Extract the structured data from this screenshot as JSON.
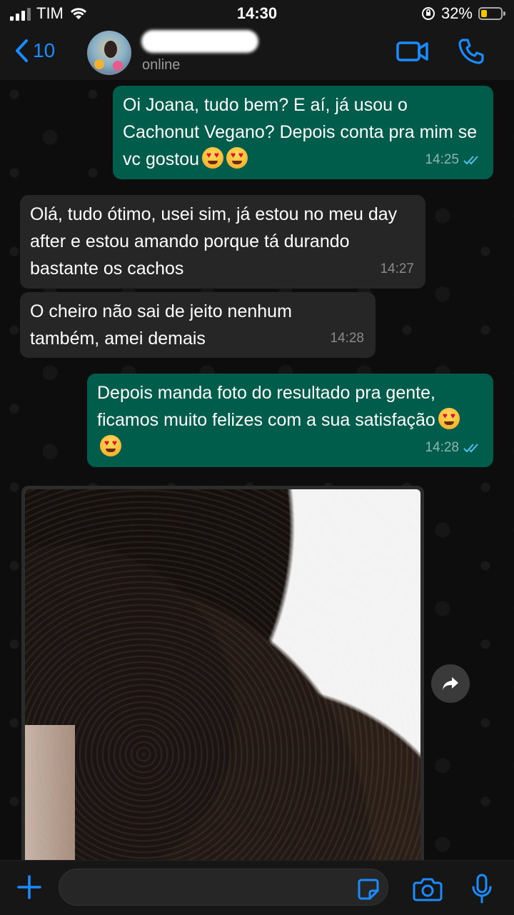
{
  "status_bar": {
    "carrier": "TIM",
    "time": "14:30",
    "battery_percent": "32%",
    "battery_level": 0.32
  },
  "header": {
    "back_count": "10",
    "contact_status": "online",
    "accent_color": "#1a8cff"
  },
  "messages": [
    {
      "direction": "outgoing",
      "text": "Oi Joana, tudo bem? E aí, já usou o Cachonut Vegano? Depois conta pra mim se vc gostou",
      "emoji": "heart-eyes-emoji x2",
      "time": "14:25",
      "ticks": "read"
    },
    {
      "direction": "incoming",
      "text": "Olá, tudo ótimo, usei sim, já estou no meu day after e estou amando porque tá durando bastante os cachos",
      "time": "14:27"
    },
    {
      "direction": "incoming",
      "text": "O cheiro não sai de jeito nenhum também, amei demais",
      "time": "14:28"
    },
    {
      "direction": "outgoing",
      "text": "Depois manda foto do resultado pra gente, ficamos muito felizes com a sua satisfação",
      "emoji": "heart-eyes-emoji x2",
      "time": "14:28",
      "ticks": "read"
    }
  ],
  "photo_message": {
    "content": "curly-hair-photo",
    "direction": "incoming"
  },
  "input": {
    "placeholder": ""
  },
  "colors": {
    "outgoing_bubble": "#005c4b",
    "incoming_bubble": "#262626",
    "read_ticks": "#53bdeb"
  }
}
